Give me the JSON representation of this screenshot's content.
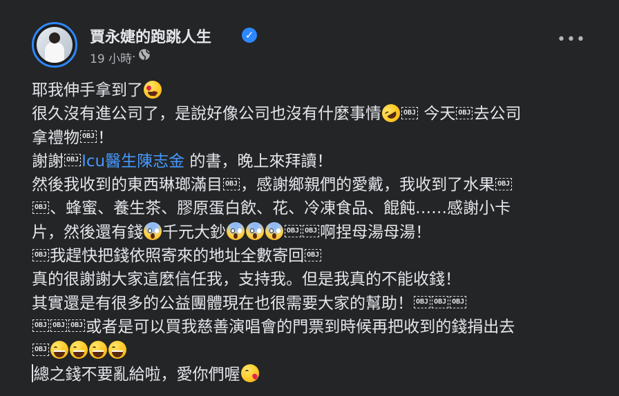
{
  "header": {
    "author_name": "賈永婕的跑跳人生",
    "timestamp": "19 小時",
    "separator": " · ",
    "verified_icon": "check-badge",
    "privacy_icon": "globe-icon",
    "more_label": "•••"
  },
  "obj": "OBJ",
  "post": {
    "l1": "耶我伸手拿到了",
    "l2a": "很久沒有進公司了，是說好像公司也沒有什麼事情",
    "l2b": " 今天",
    "l2c": "去公司",
    "l3a": "拿禮物",
    "l3b": "！",
    "l4a": "謝謝",
    "l4link": "Icu醫生陳志金",
    "l4b": " 的書，晚上來拜讀！",
    "l5a": "然後我收到的東西琳瑯滿目",
    "l5b": "，感謝鄉親們的愛戴，我收到了水果",
    "l6a": "、蜂蜜、養生茶、膠原蛋白飲、花、冷凍食品、餛飩……感謝小卡",
    "l7a": "片，然後還有錢",
    "l7b": "千元大鈔",
    "l7c": "啊捏母湯母湯！",
    "l8a": "我趕快把錢依照寄來的地址全數寄回",
    "l9": "真的很謝謝大家這麼信任我，支持我。但是我真的不能收錢！",
    "l10": "其實還是有很多的公益團體現在也很需要大家的幫助！",
    "l11": "或者是可以買我慈善演唱會的門票到時候再把收到的錢捐出去",
    "l13": "總之錢不要亂給啦，愛你們喔"
  }
}
